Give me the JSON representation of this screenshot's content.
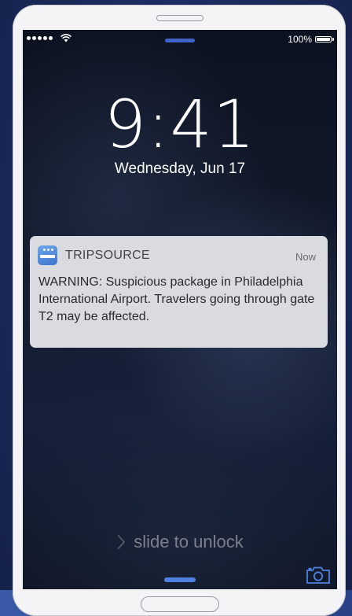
{
  "status_bar": {
    "battery_percent": "100%",
    "signal_dots": 5
  },
  "lock_screen": {
    "time": "9:41",
    "date": "Wednesday, Jun 17"
  },
  "notification": {
    "app_name": "TRIPSOURCE",
    "timestamp": "Now",
    "message": "WARNING: Suspicious package in Philadelphia International Airport. Travelers going through gate T2 may be affected."
  },
  "unlock": {
    "label": "slide to unlock"
  },
  "icons": {
    "app_icon": "tripsource-app-icon",
    "camera": "camera-icon",
    "wifi": "wifi-icon",
    "battery": "battery-icon",
    "chevron": "chevron-right-icon"
  },
  "colors": {
    "accent_blue": "#4f82e0",
    "notification_bg": "#e2e3e7",
    "background": "#1b2a5c"
  }
}
